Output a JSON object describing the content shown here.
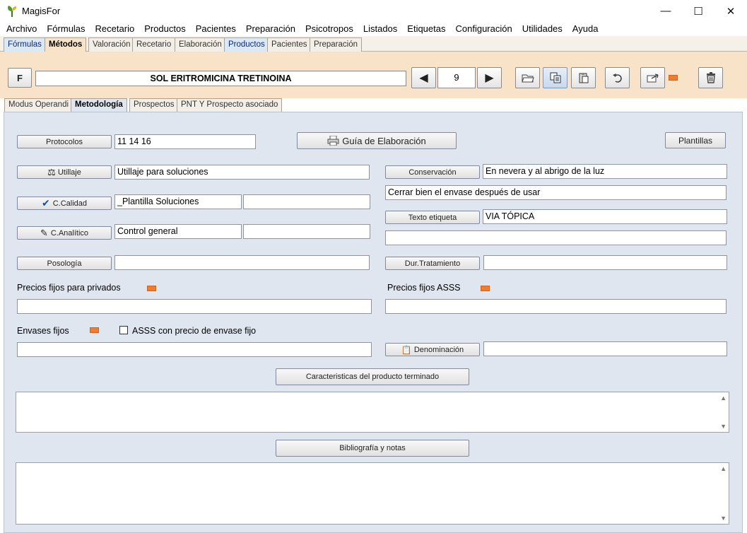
{
  "app": {
    "title": "MagisFor",
    "window_controls": {
      "minimize": "—",
      "maximize": "☐",
      "close": "✕"
    }
  },
  "menu": [
    "Archivo",
    "Fórmulas",
    "Recetario",
    "Productos",
    "Pacientes",
    "Preparación",
    "Psicotropos",
    "Listados",
    "Etiquetas",
    "Configuración",
    "Utilidades",
    "Ayuda"
  ],
  "main_tabs": [
    "Fórmulas",
    "Métodos",
    "Valoración",
    "Recetario",
    "Elaboración",
    "Productos",
    "Pacientes",
    "Preparación"
  ],
  "main_tabs_active": "Métodos",
  "header": {
    "f_button": "F",
    "product_name": "SOL ERITROMICINA TRETINOINA",
    "record_number": "9",
    "prev_icon": "◀",
    "next_icon": "▶"
  },
  "sub_tabs": [
    "Modus Operandi",
    "Metodología",
    "Prospectos",
    "PNT Y Prospecto asociado"
  ],
  "sub_tabs_active": "Metodología",
  "form": {
    "protocolos_label": "Protocolos",
    "protocolos_value": "11 14 16",
    "guia_label": "Guía de Elaboración",
    "plantillas_label": "Plantillas",
    "utillaje_label": "Utillaje",
    "utillaje_value": "Utillaje para soluciones",
    "conservacion_label": "Conservación",
    "conservacion_value": "En nevera y al abrigo de la luz",
    "conservacion_value2": "Cerrar bien el envase después de usar",
    "calidad_label": "C.Calidad",
    "calidad_value": "_Plantilla Soluciones",
    "calidad_value2": "",
    "texto_etiqueta_label": "Texto etiqueta",
    "texto_etiqueta_value": "VIA TÓPICA",
    "texto_etiqueta_value2": "",
    "analitico_label": "C.Analítico",
    "analitico_value": "Control general",
    "analitico_value2": "",
    "posologia_label": "Posología",
    "posologia_value": "",
    "dur_tratamiento_label": "Dur.Tratamiento",
    "dur_tratamiento_value": "",
    "precios_privados_label": "Precios fijos para privados",
    "precios_privados_value": "",
    "precios_asss_label": "Precios fijos ASSS",
    "precios_asss_value": "",
    "envases_label": "Envases fijos",
    "envases_value": "",
    "asss_checkbox_label": "ASSS con precio de envase fijo",
    "asss_checkbox_checked": false,
    "denominacion_label": "Denominación",
    "denominacion_value": "",
    "caracteristicas_label": "Caracteristicas del producto terminado",
    "caracteristicas_value": "",
    "bibliografia_label": "Bibliografía y notas",
    "bibliografia_value": ""
  },
  "colors": {
    "header_bg": "#f8e2c8",
    "panel_bg": "#dfe6ef",
    "indicator": "#f07d2e"
  }
}
